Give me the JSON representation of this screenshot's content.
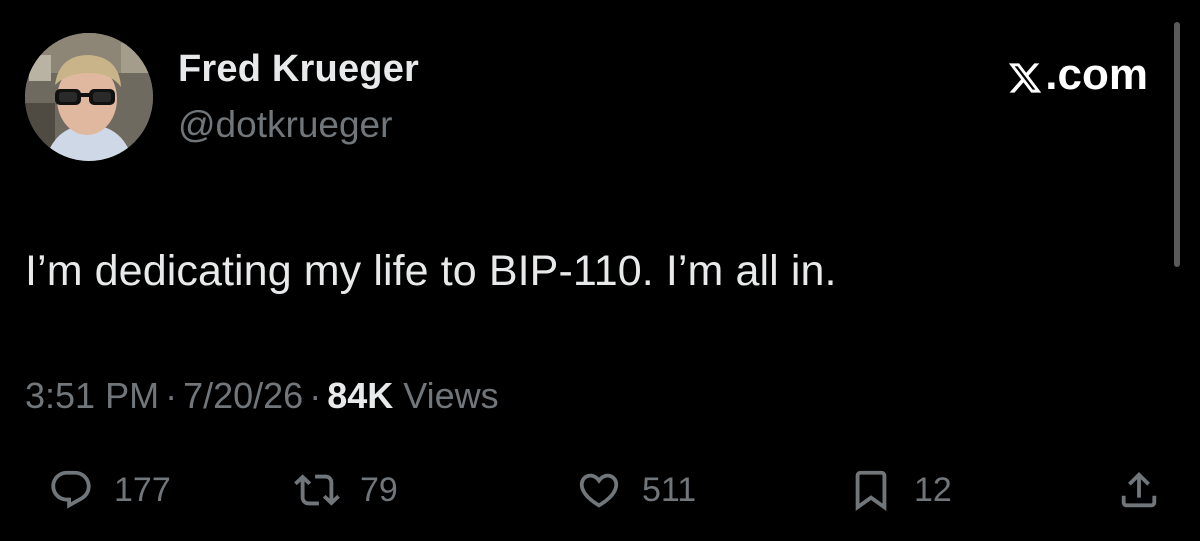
{
  "author": {
    "display_name": "Fred Krueger",
    "handle": "@dotkrueger"
  },
  "brand": {
    "label": ".com",
    "icon": "x-logo-icon"
  },
  "tweet": {
    "text": "I’m dedicating my life to BIP-110. I’m all in."
  },
  "meta": {
    "time": "3:51 PM",
    "separator": "·",
    "date": "7/20/26",
    "views_count": "84K",
    "views_label": "Views"
  },
  "actions": {
    "reply": {
      "icon": "reply-icon",
      "count": "177"
    },
    "retweet": {
      "icon": "retweet-icon",
      "count": "79"
    },
    "like": {
      "icon": "heart-icon",
      "count": "511"
    },
    "bookmark": {
      "icon": "bookmark-icon",
      "count": "12"
    },
    "share": {
      "icon": "share-icon"
    }
  },
  "colors": {
    "background": "#000000",
    "primary_text": "#e7e9ea",
    "secondary_text": "#71767b"
  }
}
